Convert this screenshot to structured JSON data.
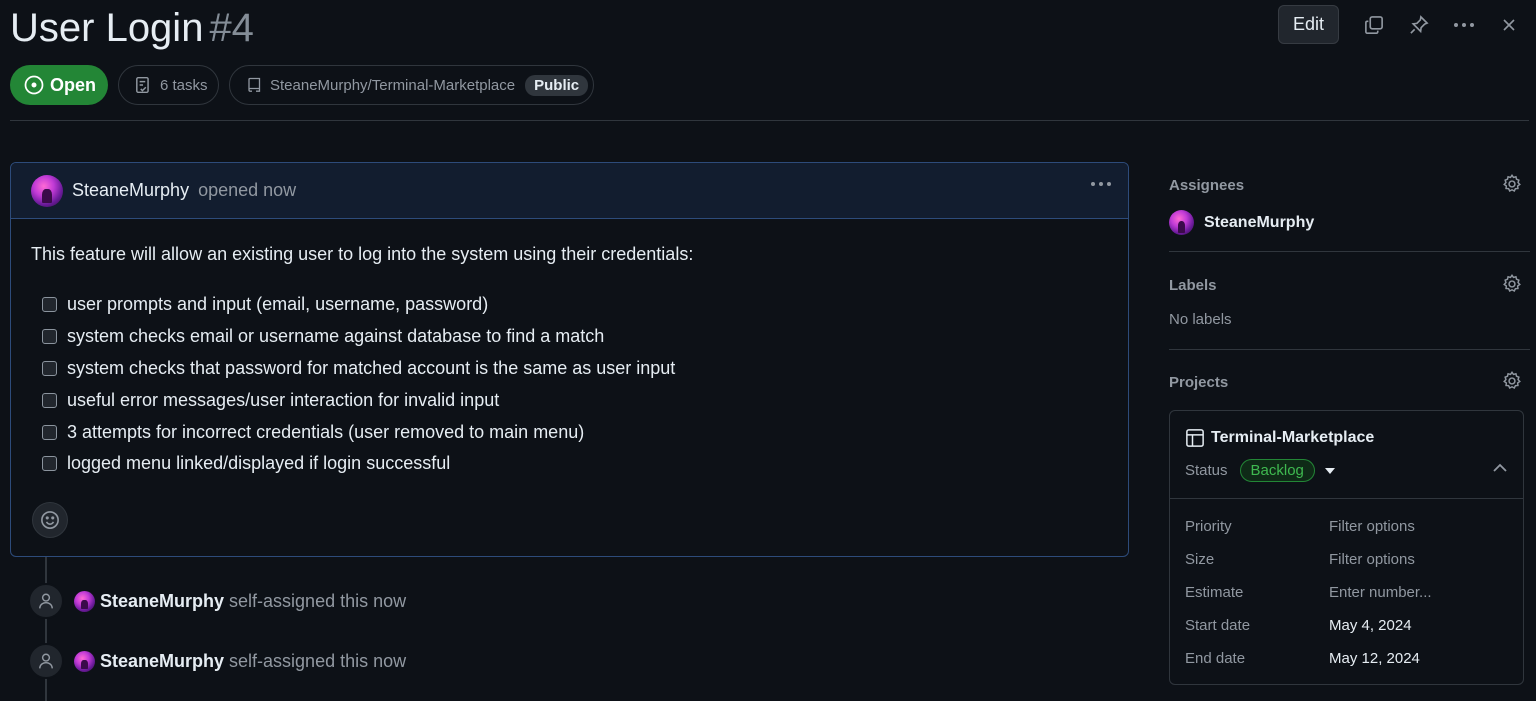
{
  "header": {
    "title": "User Login",
    "number": "#4",
    "edit_label": "Edit"
  },
  "meta": {
    "status": "Open",
    "tasks": "6 tasks",
    "repo": "SteaneMurphy/Terminal-Marketplace",
    "visibility": "Public"
  },
  "comment": {
    "author": "SteaneMurphy",
    "action": "opened now",
    "intro": "This feature will allow an existing user to log into the system using their credentials:",
    "tasks": [
      "user prompts and input (email, username, password)",
      "system checks email or username against database to find a match",
      "system checks that password for matched account is the same as user input",
      "useful error messages/user interaction for invalid input",
      "3 attempts for incorrect credentials (user removed to main menu)",
      "logged menu linked/displayed if login successful"
    ]
  },
  "timeline": [
    {
      "author": "SteaneMurphy",
      "text": "self-assigned this now"
    },
    {
      "author": "SteaneMurphy",
      "text": "self-assigned this now"
    }
  ],
  "sidebar": {
    "assignees_heading": "Assignees",
    "assignee": "SteaneMurphy",
    "labels_heading": "Labels",
    "labels_empty": "No labels",
    "projects_heading": "Projects",
    "project": {
      "name": "Terminal-Marketplace",
      "status_label": "Status",
      "status_value": "Backlog",
      "fields": [
        {
          "key": "Priority",
          "value": "Filter options"
        },
        {
          "key": "Size",
          "value": "Filter options"
        },
        {
          "key": "Estimate",
          "value": "Enter number..."
        },
        {
          "key": "Start date",
          "value": "May 4, 2024"
        },
        {
          "key": "End date",
          "value": "May 12, 2024"
        }
      ]
    }
  },
  "colors": {
    "open_badge": "#238636",
    "backlog": "#3fb950",
    "background": "#0d1117"
  }
}
